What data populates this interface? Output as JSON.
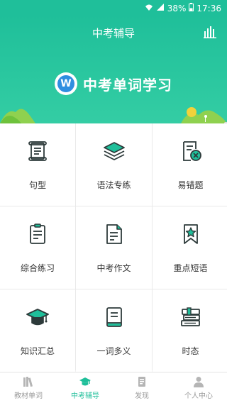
{
  "status_bar": {
    "battery": "38%",
    "time": "17:36"
  },
  "header": {
    "title": "中考辅导",
    "hero_title": "中考单词学习",
    "logo_letter": "W"
  },
  "grid_items": [
    {
      "label": "句型",
      "icon": "scroll-icon"
    },
    {
      "label": "语法专练",
      "icon": "layers-icon"
    },
    {
      "label": "易错题",
      "icon": "error-doc-icon"
    },
    {
      "label": "综合练习",
      "icon": "clipboard-icon"
    },
    {
      "label": "中考作文",
      "icon": "document-icon"
    },
    {
      "label": "重点短语",
      "icon": "star-bookmark-icon"
    },
    {
      "label": "知识汇总",
      "icon": "graduation-cap-icon"
    },
    {
      "label": "一词多义",
      "icon": "book-icon"
    },
    {
      "label": "时态",
      "icon": "books-stack-icon"
    }
  ],
  "tabs": [
    {
      "label": "教材单词",
      "icon": "books-icon",
      "active": false
    },
    {
      "label": "中考辅导",
      "icon": "graduation-cap-icon",
      "active": true
    },
    {
      "label": "发现",
      "icon": "discover-icon",
      "active": false
    },
    {
      "label": "个人中心",
      "icon": "person-icon",
      "active": false
    }
  ],
  "colors": {
    "primary": "#1fbf9a",
    "icon_dark": "#2d3a3a",
    "tab_inactive": "#9a9a9a"
  }
}
